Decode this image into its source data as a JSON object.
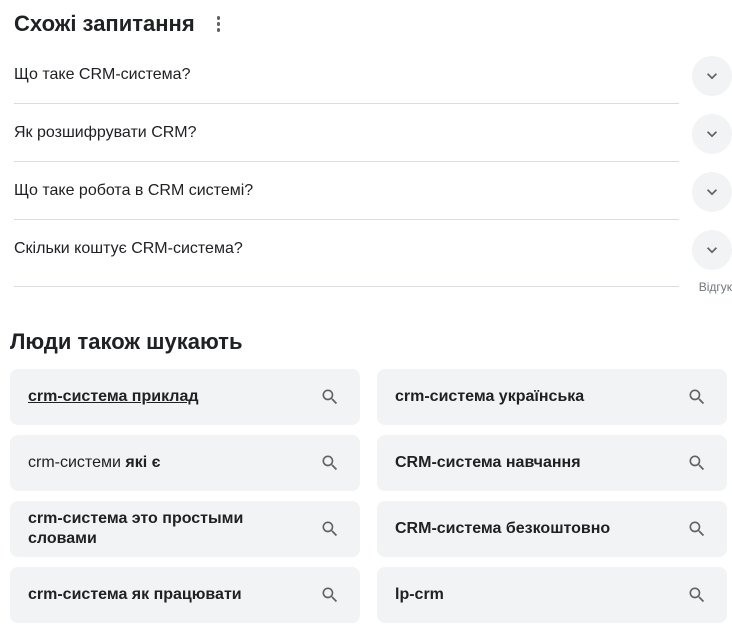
{
  "paa": {
    "title": "Схожі запитання",
    "items": [
      {
        "question": "Що таке CRM-система?"
      },
      {
        "question": "Як розшифрувати CRM?"
      },
      {
        "question": "Що таке робота в CRM системі?"
      },
      {
        "question": "Скільки коштує CRM-система?"
      }
    ],
    "feedback": "Відгук"
  },
  "pas": {
    "title": "Люди також шукають",
    "chips": [
      {
        "bold": "crm-система приклад",
        "normal": ""
      },
      {
        "bold": "crm-система українська",
        "normal": ""
      },
      {
        "normal": "crm-системи ",
        "bold": "які є"
      },
      {
        "bold": "CRM-система навчання",
        "normal": ""
      },
      {
        "bold": "crm-система это простыми словами",
        "normal": ""
      },
      {
        "bold": "CRM-система безкоштовно",
        "normal": ""
      },
      {
        "bold": "crm-система як працювати",
        "normal": ""
      },
      {
        "bold": "lp-crm",
        "normal": ""
      }
    ]
  },
  "icons": {
    "more": "more-vert-icon",
    "expand": "chevron-down-icon",
    "search": "search-icon"
  },
  "colors": {
    "text": "#202124",
    "secondary": "#70757a",
    "chip_bg": "#f1f3f4",
    "divider": "#dadce0",
    "icon": "#5f6368"
  }
}
